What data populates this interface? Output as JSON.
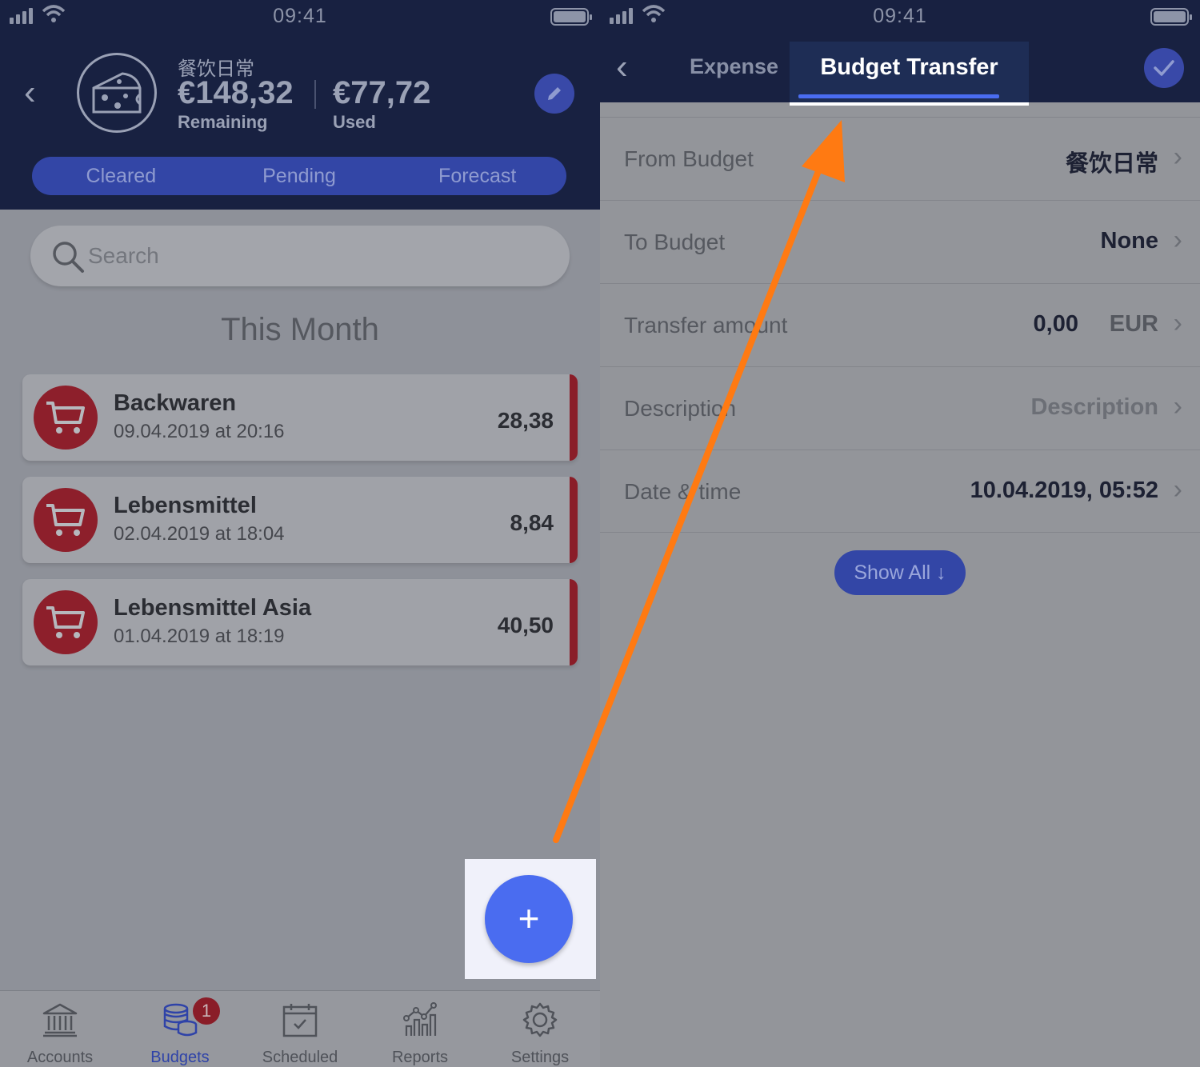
{
  "status": {
    "time": "09:41"
  },
  "left": {
    "budget": {
      "name": "餐饮日常",
      "remaining": "€148,32",
      "remaining_label": "Remaining",
      "used": "€77,72",
      "used_label": "Used"
    },
    "segments": [
      "Cleared",
      "Pending",
      "Forecast"
    ],
    "search": {
      "placeholder": "Search"
    },
    "section_title": "This Month",
    "transactions": [
      {
        "name": "Backwaren",
        "date": "09.04.2019 at 20:16",
        "amount": "28,38"
      },
      {
        "name": "Lebensmittel",
        "date": "02.04.2019 at 18:04",
        "amount": "8,84"
      },
      {
        "name": "Lebensmittel Asia",
        "date": "01.04.2019 at 18:19",
        "amount": "40,50"
      }
    ],
    "fab": {
      "label": "+"
    },
    "tabbar": {
      "items": [
        {
          "label": "Accounts",
          "icon": "bank-icon"
        },
        {
          "label": "Budgets",
          "icon": "coins-icon",
          "badge": "1"
        },
        {
          "label": "Scheduled",
          "icon": "calendar-check-icon"
        },
        {
          "label": "Reports",
          "icon": "chart-icon"
        },
        {
          "label": "Settings",
          "icon": "gear-icon"
        }
      ],
      "active": "Budgets"
    }
  },
  "right": {
    "tabs": {
      "expense": "Expense",
      "budget_transfer": "Budget Transfer",
      "active": "Budget Transfer"
    },
    "rows": {
      "from_budget": {
        "label": "From Budget",
        "value": "餐饮日常"
      },
      "to_budget": {
        "label": "To Budget",
        "value": "None"
      },
      "transfer_amount": {
        "label": "Transfer amount",
        "value": "0,00",
        "currency": "EUR"
      },
      "description": {
        "label": "Description",
        "placeholder": "Description"
      },
      "date_time": {
        "label": "Date & time",
        "value": "10.04.2019, 05:52"
      }
    },
    "show_all": "Show All ↓"
  },
  "colors": {
    "header": "#182141",
    "accent": "#4a6cf0",
    "segment": "#3346a6",
    "expense_bar": "#8a1d28",
    "annotation_arrow": "#ff7a12"
  }
}
